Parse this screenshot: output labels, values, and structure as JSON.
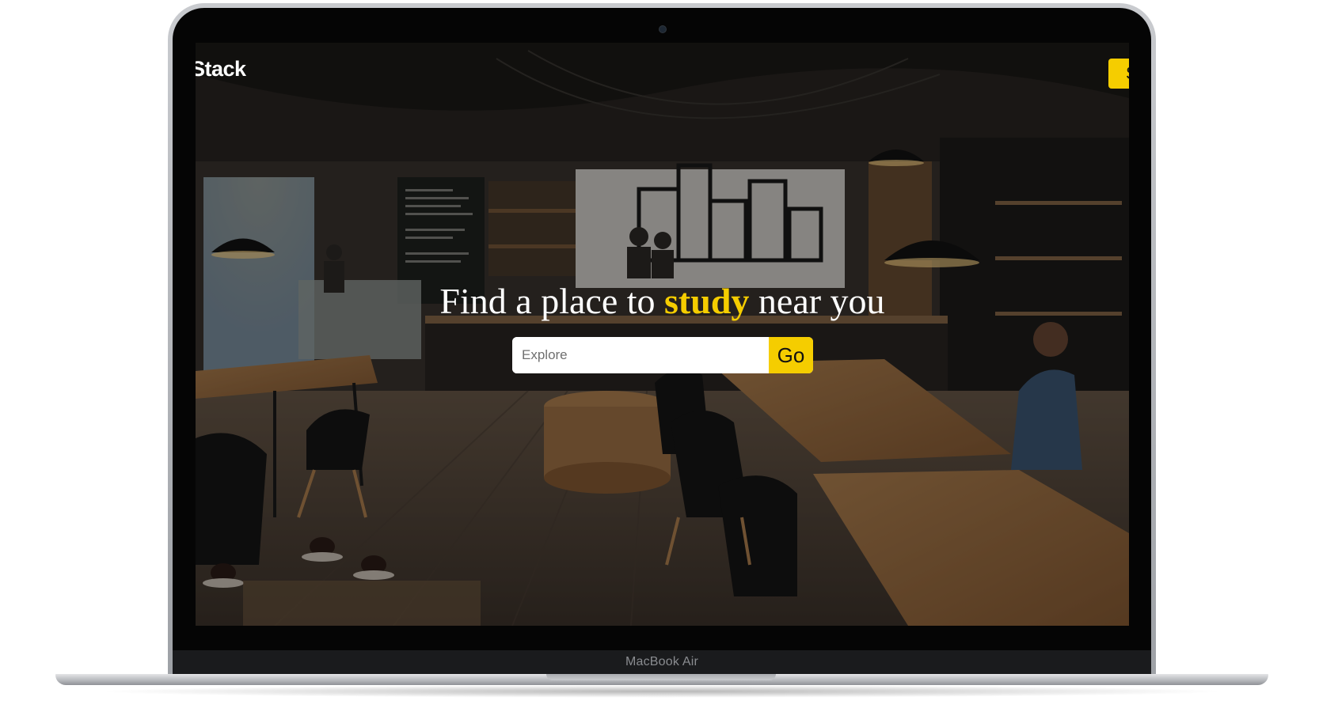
{
  "device": {
    "label": "MacBook Air"
  },
  "site": {
    "brand": "Stack",
    "nav_button_label": "S"
  },
  "hero": {
    "title_before": "Find a place to ",
    "title_accent": "study",
    "title_after": " near you",
    "search_placeholder": "Explore",
    "search_value": "",
    "go_label": "Go"
  },
  "colors": {
    "accent": "#f5cd00",
    "overlay": "rgba(0,0,0,0.38)",
    "text": "#ffffff"
  },
  "background": {
    "subject": "cafe-interior-photo"
  }
}
